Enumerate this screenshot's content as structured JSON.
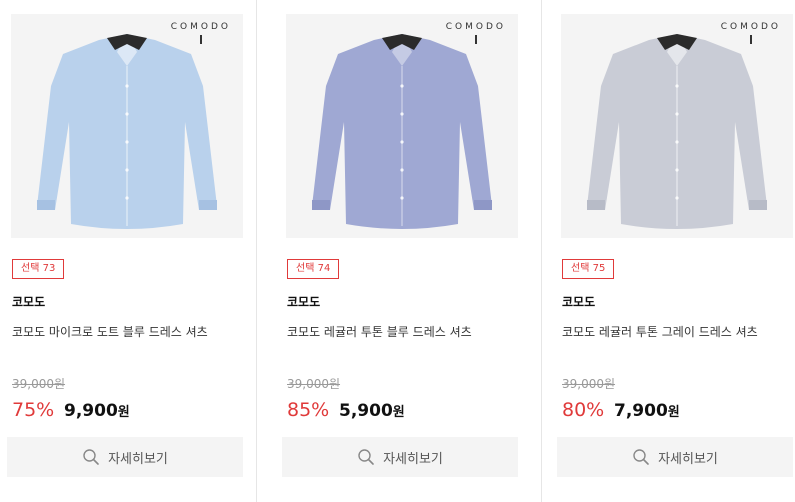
{
  "products": [
    {
      "logo_text": "COMODO",
      "badge": "선택 73",
      "brand": "코모도",
      "name": "코모도 마이크로 도트 블루 드레스 셔츠",
      "original_price": "39,000원",
      "discount": "75%",
      "sale_price": "9,900",
      "currency": "원",
      "detail_label": "자세히보기",
      "shirt_color": "#b9d1ec",
      "shirt_shade": "#a6c1e2"
    },
    {
      "logo_text": "COMODO",
      "badge": "선택 74",
      "brand": "코모도",
      "name": "코모도 레귤러 투톤 블루 드레스 셔츠",
      "original_price": "39,000원",
      "discount": "85%",
      "sale_price": "5,900",
      "currency": "원",
      "detail_label": "자세히보기",
      "shirt_color": "#9fa8d3",
      "shirt_shade": "#8e97c6"
    },
    {
      "logo_text": "COMODO",
      "badge": "선택 75",
      "brand": "코모도",
      "name": "코모도 레귤러 투톤 그레이 드레스 셔츠",
      "original_price": "39,000원",
      "discount": "80%",
      "sale_price": "7,900",
      "currency": "원",
      "detail_label": "자세히보기",
      "shirt_color": "#c9ccd6",
      "shirt_shade": "#b7bbc7"
    }
  ],
  "colors": {
    "accent_red": "#e03a3a",
    "button_bg": "#f4f4f4",
    "image_bg": "#f4f4f4"
  },
  "icons": {
    "detail_button": "search-icon"
  }
}
